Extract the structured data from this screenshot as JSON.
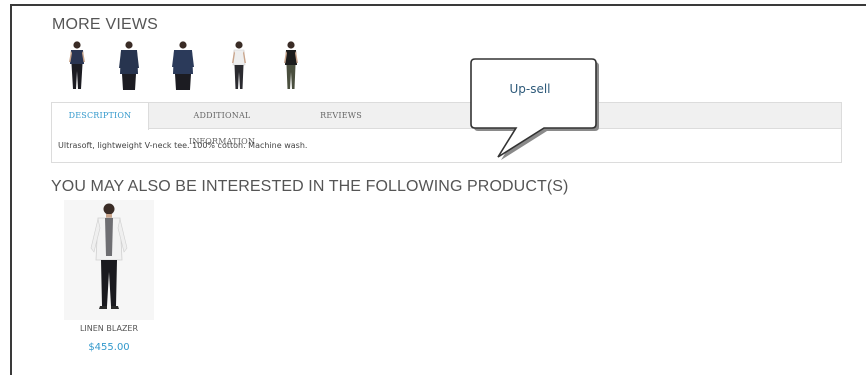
{
  "more_views": {
    "title": "MORE VIEWS",
    "thumbnails": [
      {
        "icon": "model-navy-tee-icon"
      },
      {
        "icon": "model-navy-tee-front-icon"
      },
      {
        "icon": "model-navy-tee-back-icon"
      },
      {
        "icon": "model-white-tee-icon"
      },
      {
        "icon": "model-black-tee-icon"
      }
    ]
  },
  "tabs": {
    "items": [
      {
        "label": "DESCRIPTION",
        "active": true
      },
      {
        "label": "ADDITIONAL INFORMATION",
        "active": false
      },
      {
        "label": "REVIEWS",
        "active": false
      }
    ],
    "content": "Ultrasoft, lightweight V-neck tee. 100% cotton. Machine wash."
  },
  "callout": {
    "label": "Up-sell"
  },
  "upsell": {
    "title": "YOU MAY ALSO BE INTERESTED IN THE FOLLOWING PRODUCT(S)",
    "products": [
      {
        "name": "LINEN BLAZER",
        "price": "$455.00",
        "icon": "model-linen-blazer-icon"
      }
    ]
  },
  "colors": {
    "accent": "#3399cc",
    "callout_text": "#2e5a7a",
    "frame": "#3a3a3a"
  }
}
